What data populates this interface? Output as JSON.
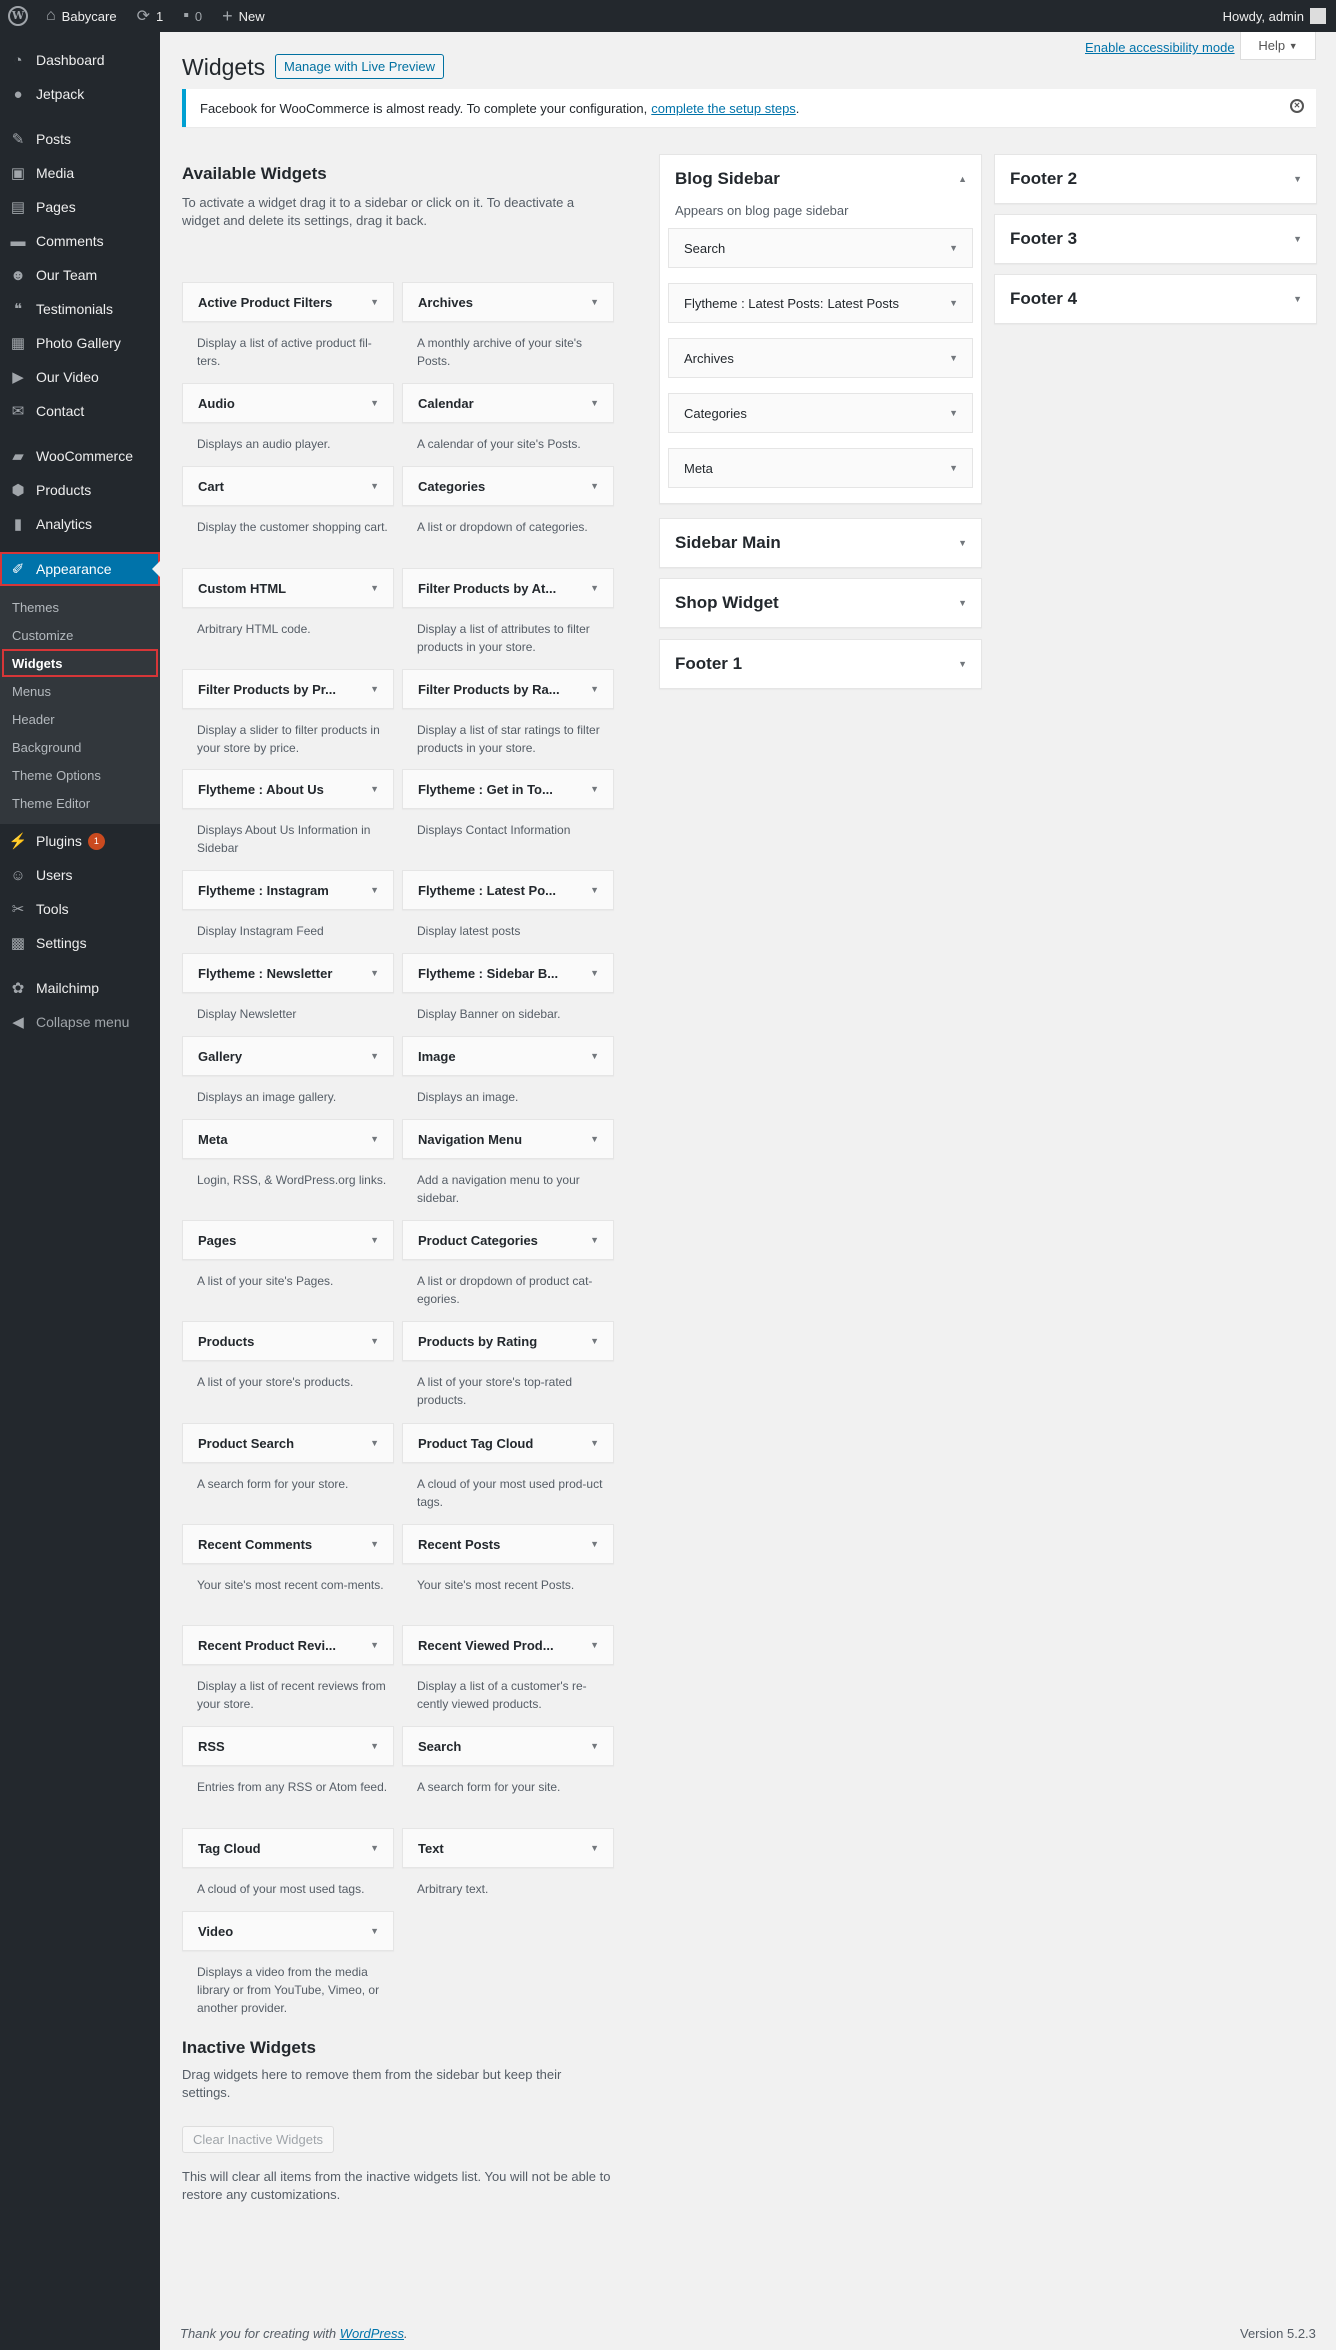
{
  "admin_bar": {
    "site_name": "Babycare",
    "updates_count": "1",
    "comments_count": "0",
    "new_label": "New",
    "howdy": "Howdy, admin"
  },
  "sidebar": {
    "items": [
      {
        "label": "Dashboard",
        "icon": "dashboard-icon"
      },
      {
        "label": "Jetpack",
        "icon": "jetpack-icon"
      },
      {
        "label": "Posts",
        "icon": "pin-icon"
      },
      {
        "label": "Media",
        "icon": "media-icon"
      },
      {
        "label": "Pages",
        "icon": "pages-icon"
      },
      {
        "label": "Comments",
        "icon": "comments-icon"
      },
      {
        "label": "Our Team",
        "icon": "team-icon"
      },
      {
        "label": "Testimonials",
        "icon": "quote-icon"
      },
      {
        "label": "Photo Gallery",
        "icon": "gallery-icon"
      },
      {
        "label": "Our Video",
        "icon": "video-icon"
      },
      {
        "label": "Contact",
        "icon": "mail-icon"
      },
      {
        "label": "WooCommerce",
        "icon": "woocommerce-icon"
      },
      {
        "label": "Products",
        "icon": "products-icon"
      },
      {
        "label": "Analytics",
        "icon": "analytics-icon"
      },
      {
        "label": "Appearance",
        "icon": "brush-icon"
      }
    ],
    "appearance_sub": [
      "Themes",
      "Customize",
      "Widgets",
      "Menus",
      "Header",
      "Background",
      "Theme Options",
      "Theme Editor"
    ],
    "lower_items": [
      {
        "label": "Plugins",
        "badge": "1"
      },
      {
        "label": "Users"
      },
      {
        "label": "Tools"
      },
      {
        "label": "Settings"
      },
      {
        "label": "Mailchimp"
      },
      {
        "label": "Collapse menu"
      }
    ]
  },
  "header": {
    "title": "Widgets",
    "live_preview": "Manage with Live Preview",
    "accessibility": "Enable accessibility mode",
    "help": "Help"
  },
  "notice": {
    "text": "Facebook for WooCommerce is almost ready. To complete your configuration,",
    "link": "complete the setup steps",
    "tail": "."
  },
  "available": {
    "title": "Available Widgets",
    "description": "To activate a widget drag it to a sidebar or click on it. To deactivate a widget and delete its settings, drag it back.",
    "widgets": [
      {
        "title": "Active Product Filters",
        "desc": "Display a list of active product fil-ters."
      },
      {
        "title": "Archives",
        "desc": "A monthly archive of your site's Posts."
      },
      {
        "title": "Audio",
        "desc": "Displays an audio player."
      },
      {
        "title": "Calendar",
        "desc": "A calendar of your site's Posts."
      },
      {
        "title": "Cart",
        "desc": "Display the customer shopping cart."
      },
      {
        "title": "Categories",
        "desc": "A list or dropdown of categories."
      },
      {
        "title": "Custom HTML",
        "desc": "Arbitrary HTML code."
      },
      {
        "title": "Filter Products by At...",
        "desc": "Display a list of attributes to filter products in your store."
      },
      {
        "title": "Filter Products by Pr...",
        "desc": "Display a slider to filter products in your store by price."
      },
      {
        "title": "Filter Products by Ra...",
        "desc": "Display a list of star ratings to filter products in your store."
      },
      {
        "title": "Flytheme : About Us",
        "desc": "Displays About Us Information in Sidebar"
      },
      {
        "title": "Flytheme : Get in To...",
        "desc": "Displays Contact Information"
      },
      {
        "title": "Flytheme : Instagram",
        "desc": "Display Instagram Feed"
      },
      {
        "title": "Flytheme : Latest Po...",
        "desc": "Display latest posts"
      },
      {
        "title": "Flytheme : Newsletter",
        "desc": "Display Newsletter"
      },
      {
        "title": "Flytheme : Sidebar B...",
        "desc": "Display Banner on sidebar."
      },
      {
        "title": "Gallery",
        "desc": "Displays an image gallery."
      },
      {
        "title": "Image",
        "desc": "Displays an image."
      },
      {
        "title": "Meta",
        "desc": "Login, RSS, & WordPress.org links."
      },
      {
        "title": "Navigation Menu",
        "desc": "Add a navigation menu to your sidebar."
      },
      {
        "title": "Pages",
        "desc": "A list of your site's Pages."
      },
      {
        "title": "Product Categories",
        "desc": "A list or dropdown of product cat-egories."
      },
      {
        "title": "Products",
        "desc": "A list of your store's products."
      },
      {
        "title": "Products by Rating",
        "desc": "A list of your store's top-rated products."
      },
      {
        "title": "Product Search",
        "desc": "A search form for your store."
      },
      {
        "title": "Product Tag Cloud",
        "desc": "A cloud of your most used prod-uct tags."
      },
      {
        "title": "Recent Comments",
        "desc": "Your site's most recent com-ments."
      },
      {
        "title": "Recent Posts",
        "desc": "Your site's most recent Posts."
      },
      {
        "title": "Recent Product Revi...",
        "desc": "Display a list of recent reviews from your store."
      },
      {
        "title": "Recent Viewed Prod...",
        "desc": "Display a list of a customer's re-cently viewed products."
      },
      {
        "title": "RSS",
        "desc": "Entries from any RSS or Atom feed."
      },
      {
        "title": "Search",
        "desc": "A search form for your site."
      },
      {
        "title": "Tag Cloud",
        "desc": "A cloud of your most used tags."
      },
      {
        "title": "Text",
        "desc": "Arbitrary text."
      },
      {
        "title": "Video",
        "desc": "Displays a video from the media library or from YouTube, Vimeo, or another provider."
      }
    ]
  },
  "blog_sidebar": {
    "title": "Blog Sidebar",
    "description": "Appears on blog page sidebar",
    "widgets": [
      {
        "title": "Search",
        "sub": ""
      },
      {
        "title": "Flytheme : Latest Posts:",
        "sub": "Latest Posts"
      },
      {
        "title": "Archives",
        "sub": ""
      },
      {
        "title": "Categories",
        "sub": ""
      },
      {
        "title": "Meta",
        "sub": ""
      }
    ]
  },
  "other_sidebars": {
    "col2": [
      "Sidebar Main",
      "Shop Widget",
      "Footer 1"
    ],
    "col3": [
      "Footer 2",
      "Footer 3",
      "Footer 4"
    ]
  },
  "inactive": {
    "title": "Inactive Widgets",
    "description": "Drag widgets here to remove them from the sidebar but keep their settings.",
    "button": "Clear Inactive Widgets",
    "note": "This will clear all items from the inactive widgets list. You will not be able to restore any customizations."
  },
  "footer": {
    "thanks": "Thank you for creating with",
    "link": "WordPress",
    "tail": ".",
    "version": "Version 5.2.3"
  }
}
